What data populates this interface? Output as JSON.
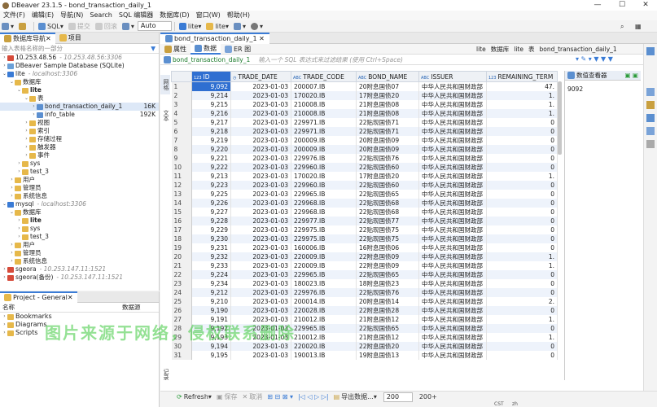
{
  "window": {
    "title": "DBeaver 23.1.5 - bond_transaction_daily_1",
    "min": "—",
    "max": "☐",
    "close": "✕"
  },
  "menu": [
    "文件(F)",
    "编辑(E)",
    "导航(N)",
    "Search",
    "SQL 编辑器",
    "数据库(D)",
    "窗口(W)",
    "帮助(H)"
  ],
  "toolbar": {
    "sql": "SQL",
    "submit": "提交",
    "rollback": "回滚",
    "auto": "Auto",
    "schema1": "lite",
    "schema2": "lite"
  },
  "navigator": {
    "tab_active": "数据库导航",
    "tab_project": "项目",
    "filter_placeholder": "输入表格名称的一部分",
    "tree": [
      {
        "label": "10.253.48.56",
        "sub": "- 10.253.48.56:3306",
        "depth": 0,
        "arrow": "›",
        "color": "#d64b3a"
      },
      {
        "label": "DBeaver Sample Database (SQLite)",
        "sub": "",
        "depth": 0,
        "arrow": "›",
        "color": "#6aa0d8"
      },
      {
        "label": "lite",
        "sub": "- localhost:3306",
        "depth": 0,
        "arrow": "⌄",
        "color": "#3a7bd5"
      },
      {
        "label": "数据库",
        "sub": "",
        "depth": 1,
        "arrow": "⌄",
        "color": "#e6b84a"
      },
      {
        "label": "lite",
        "sub": "",
        "depth": 2,
        "arrow": "⌄",
        "color": "#e6b84a",
        "bold": true
      },
      {
        "label": "表",
        "sub": "",
        "depth": 3,
        "arrow": "⌄",
        "color": "#e6b84a"
      },
      {
        "label": "bond_transaction_daily_1",
        "sub": "",
        "depth": 4,
        "arrow": "›",
        "color": "#5b8fd0",
        "size": "16K",
        "sel": true
      },
      {
        "label": "info_table",
        "sub": "",
        "depth": 4,
        "arrow": "›",
        "color": "#5b8fd0",
        "size": "192K"
      },
      {
        "label": "视图",
        "sub": "",
        "depth": 3,
        "arrow": "›",
        "color": "#e6b84a"
      },
      {
        "label": "索引",
        "sub": "",
        "depth": 3,
        "arrow": "›",
        "color": "#e6b84a"
      },
      {
        "label": "存储过程",
        "sub": "",
        "depth": 3,
        "arrow": "›",
        "color": "#e6b84a"
      },
      {
        "label": "触发器",
        "sub": "",
        "depth": 3,
        "arrow": "›",
        "color": "#e6b84a"
      },
      {
        "label": "事件",
        "sub": "",
        "depth": 3,
        "arrow": "›",
        "color": "#e6b84a"
      },
      {
        "label": "sys",
        "sub": "",
        "depth": 2,
        "arrow": "›",
        "color": "#e6b84a"
      },
      {
        "label": "test_3",
        "sub": "",
        "depth": 2,
        "arrow": "›",
        "color": "#e6b84a"
      },
      {
        "label": "用户",
        "sub": "",
        "depth": 1,
        "arrow": "›",
        "color": "#e6b84a"
      },
      {
        "label": "管理员",
        "sub": "",
        "depth": 1,
        "arrow": "›",
        "color": "#e6b84a"
      },
      {
        "label": "系统信息",
        "sub": "",
        "depth": 1,
        "arrow": "›",
        "color": "#e6b84a"
      },
      {
        "label": "mysql",
        "sub": "- localhost:3306",
        "depth": 0,
        "arrow": "⌄",
        "color": "#3a7bd5"
      },
      {
        "label": "数据库",
        "sub": "",
        "depth": 1,
        "arrow": "⌄",
        "color": "#e6b84a"
      },
      {
        "label": "lite",
        "sub": "",
        "depth": 2,
        "arrow": "›",
        "color": "#e6b84a",
        "bold": true
      },
      {
        "label": "sys",
        "sub": "",
        "depth": 2,
        "arrow": "›",
        "color": "#e6b84a"
      },
      {
        "label": "test_3",
        "sub": "",
        "depth": 2,
        "arrow": "›",
        "color": "#e6b84a"
      },
      {
        "label": "用户",
        "sub": "",
        "depth": 1,
        "arrow": "›",
        "color": "#e6b84a"
      },
      {
        "label": "管理员",
        "sub": "",
        "depth": 1,
        "arrow": "›",
        "color": "#e6b84a"
      },
      {
        "label": "系统信息",
        "sub": "",
        "depth": 1,
        "arrow": "›",
        "color": "#e6b84a"
      },
      {
        "label": "sgeora",
        "sub": "- 10.253.147.11:1521",
        "depth": 0,
        "arrow": "›",
        "color": "#d64b3a"
      },
      {
        "label": "sgeora(备份)",
        "sub": "- 10.253.147.11:1521",
        "depth": 0,
        "arrow": "›",
        "color": "#d64b3a"
      }
    ]
  },
  "project": {
    "title": "Project - General",
    "col_name": "名称",
    "col_source": "数据源",
    "items": [
      "Bookmarks",
      "Diagrams",
      "Scripts"
    ]
  },
  "editor": {
    "tab": "bond_transaction_daily_1",
    "subtabs": [
      "属性",
      "数据",
      "ER 图"
    ],
    "right_crumbs": [
      "lite",
      "数据库",
      "lite",
      "表",
      "bond_transaction_daily_1"
    ],
    "filter_table": "bond_transaction_daily_1",
    "filter_placeholder": "输入一个 SQL 表达式来过滤结果 (使用 Ctrl+Space)",
    "side_tabs": {
      "grid": "网格",
      "text": "文本",
      "record": "记录"
    },
    "value_panel_title": "数值查看器",
    "value_panel_value": "9092",
    "bottom": {
      "refresh": "Refresh",
      "save": "保存",
      "cancel": "取消",
      "export": "导出数据...",
      "limit": "200",
      "count": "200+"
    }
  },
  "grid": {
    "columns": [
      {
        "name": "ID",
        "type": "123"
      },
      {
        "name": "TRADE_DATE",
        "type": "◷"
      },
      {
        "name": "TRADE_CODE",
        "type": "ABC"
      },
      {
        "name": "BOND_NAME",
        "type": "ABC"
      },
      {
        "name": "ISSUER",
        "type": "ABC"
      },
      {
        "name": "REMAINING_TERM",
        "type": "123"
      }
    ],
    "rows": [
      [
        "1",
        "9,092",
        "2023-01-03",
        "200007.IB",
        "20附息国债07",
        "中华人民共和国财政部",
        "47."
      ],
      [
        "2",
        "9,214",
        "2023-01-03",
        "170020.IB",
        "17附息国债20",
        "中华人民共和国财政部",
        "1."
      ],
      [
        "3",
        "9,215",
        "2023-01-03",
        "210008.IB",
        "21附息国债08",
        "中华人民共和国财政部",
        "1."
      ],
      [
        "4",
        "9,216",
        "2023-01-03",
        "210008.IB",
        "21附息国债08",
        "中华人民共和国财政部",
        "1."
      ],
      [
        "5",
        "9,217",
        "2023-01-03",
        "229971.IB",
        "22贴现国债71",
        "中华人民共和国财政部",
        "0"
      ],
      [
        "6",
        "9,218",
        "2023-01-03",
        "229971.IB",
        "22贴现国债71",
        "中华人民共和国财政部",
        "0"
      ],
      [
        "7",
        "9,219",
        "2023-01-03",
        "200009.IB",
        "20附息国债09",
        "中华人民共和国财政部",
        "0"
      ],
      [
        "8",
        "9,220",
        "2023-01-03",
        "200009.IB",
        "20附息国债09",
        "中华人民共和国财政部",
        "0"
      ],
      [
        "9",
        "9,221",
        "2023-01-03",
        "229976.IB",
        "22贴现国债76",
        "中华人民共和国财政部",
        "0"
      ],
      [
        "10",
        "9,222",
        "2023-01-03",
        "229960.IB",
        "22贴现国债60",
        "中华人民共和国财政部",
        "0"
      ],
      [
        "11",
        "9,213",
        "2023-01-03",
        "170020.IB",
        "17附息国债20",
        "中华人民共和国财政部",
        "1."
      ],
      [
        "12",
        "9,223",
        "2023-01-03",
        "229960.IB",
        "22贴现国债60",
        "中华人民共和国财政部",
        "0"
      ],
      [
        "13",
        "9,225",
        "2023-01-03",
        "229965.IB",
        "22贴现国债65",
        "中华人民共和国财政部",
        "0"
      ],
      [
        "14",
        "9,226",
        "2023-01-03",
        "229968.IB",
        "22贴现国债68",
        "中华人民共和国财政部",
        "0"
      ],
      [
        "15",
        "9,227",
        "2023-01-03",
        "229968.IB",
        "22贴现国债68",
        "中华人民共和国财政部",
        "0"
      ],
      [
        "16",
        "9,228",
        "2023-01-03",
        "229977.IB",
        "22贴现国债77",
        "中华人民共和国财政部",
        "0"
      ],
      [
        "17",
        "9,229",
        "2023-01-03",
        "229975.IB",
        "22贴现国债75",
        "中华人民共和国财政部",
        "0"
      ],
      [
        "18",
        "9,230",
        "2023-01-03",
        "229975.IB",
        "22贴现国债75",
        "中华人民共和国财政部",
        "0"
      ],
      [
        "19",
        "9,231",
        "2023-01-03",
        "160006.IB",
        "16附息国债06",
        "中华人民共和国财政部",
        "0"
      ],
      [
        "20",
        "9,232",
        "2023-01-03",
        "220009.IB",
        "22附息国债09",
        "中华人民共和国财政部",
        "1."
      ],
      [
        "21",
        "9,233",
        "2023-01-03",
        "220009.IB",
        "22附息国债09",
        "中华人民共和国财政部",
        "1."
      ],
      [
        "22",
        "9,224",
        "2023-01-03",
        "229965.IB",
        "22贴现国债65",
        "中华人民共和国财政部",
        "0"
      ],
      [
        "23",
        "9,234",
        "2023-01-03",
        "180023.IB",
        "18附息国债23",
        "中华人民共和国财政部",
        "0"
      ],
      [
        "24",
        "9,212",
        "2023-01-03",
        "229976.IB",
        "22贴现国债76",
        "中华人民共和国财政部",
        "0"
      ],
      [
        "25",
        "9,210",
        "2023-01-03",
        "200014.IB",
        "20附息国债14",
        "中华人民共和国财政部",
        "2."
      ],
      [
        "26",
        "9,190",
        "2023-01-03",
        "220028.IB",
        "22附息国债28",
        "中华人民共和国财政部",
        "0"
      ],
      [
        "27",
        "9,191",
        "2023-01-03",
        "210012.IB",
        "21附息国债12",
        "中华人民共和国财政部",
        "1."
      ],
      [
        "28",
        "9,192",
        "2023-01-03",
        "229965.IB",
        "22贴现国债65",
        "中华人民共和国财政部",
        "0"
      ],
      [
        "29",
        "9,193",
        "2023-01-03",
        "210012.IB",
        "21附息国债12",
        "中华人民共和国财政部",
        "1."
      ],
      [
        "30",
        "9,194",
        "2023-01-03",
        "220020.IB",
        "22附息国债20",
        "中华人民共和国财政部",
        "0"
      ],
      [
        "31",
        "9,195",
        "2023-01-03",
        "190013.IB",
        "19附息国债13",
        "中华人民共和国财政部",
        "0"
      ]
    ]
  },
  "watermark": "图片来源于网络，侵权联系删除",
  "status": {
    "cst": "CST",
    "lang": "zh"
  }
}
